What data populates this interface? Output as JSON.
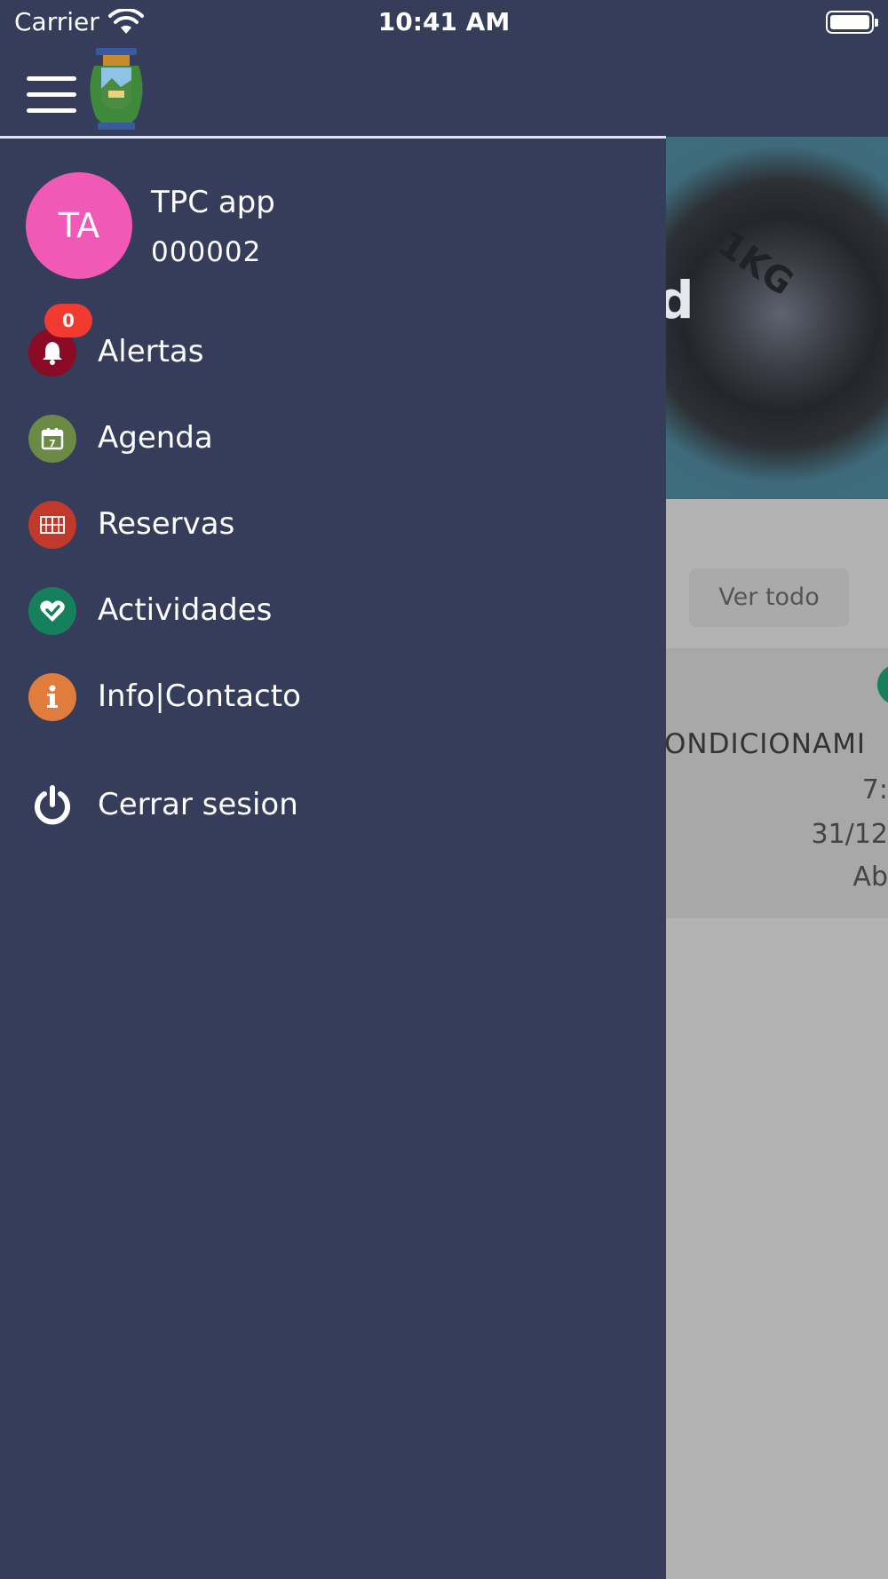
{
  "status_bar": {
    "carrier": "Carrier",
    "time": "10:41 AM"
  },
  "header": {
    "menu_icon": "hamburger-icon",
    "logo": "municipal-crest-logo"
  },
  "background": {
    "hero_partial_text": "d",
    "plate_text": "1KG",
    "ver_todo_label": "Ver todo",
    "card": {
      "title_partial": "ONDICIONAMI",
      "line1_partial": "7:",
      "line2_partial": "31/12",
      "line3_partial": "Ab"
    }
  },
  "drawer": {
    "user": {
      "initials": "TA",
      "name": "TPC app",
      "id": "000002",
      "avatar_color": "#f159b6"
    },
    "items": [
      {
        "label": "Alertas",
        "icon": "bell-icon",
        "color": "#8b0a25",
        "badge": "0"
      },
      {
        "label": "Agenda",
        "icon": "calendar-icon",
        "color": "#6a8a45"
      },
      {
        "label": "Reservas",
        "icon": "court-icon",
        "color": "#c0392b"
      },
      {
        "label": "Actividades",
        "icon": "heart-check-icon",
        "color": "#167f5c"
      },
      {
        "label": "Info|Contacto",
        "icon": "info-icon",
        "color": "#e07d3c"
      }
    ],
    "logout": {
      "label": "Cerrar sesion",
      "icon": "power-icon"
    }
  },
  "colors": {
    "header_bg": "#353d5a",
    "drawer_bg": "#353d5a",
    "overlay_bg": "#b3b3b3",
    "badge": "#f33a30"
  }
}
